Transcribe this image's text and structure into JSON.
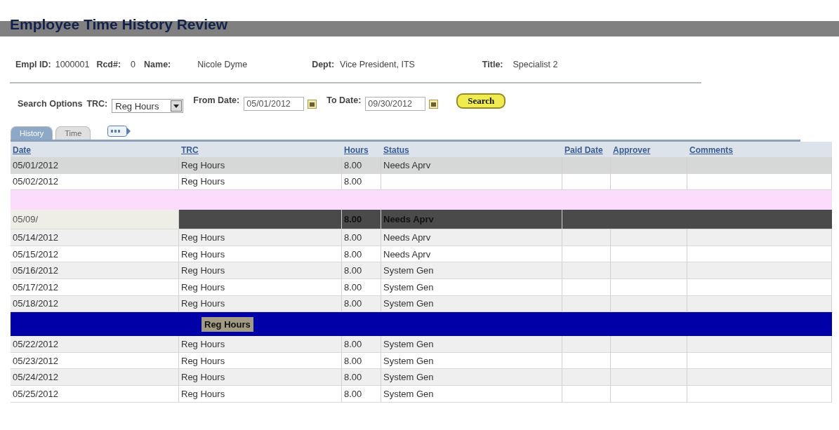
{
  "page_title": "Employee Time History Review",
  "employee": [
    {
      "label": "Empl ID:",
      "value": "1000001"
    },
    {
      "label": "Rcd#:",
      "value": "0"
    },
    {
      "label": "Name:",
      "value": "Nicole Dyme"
    },
    {
      "label": "Dept:",
      "value": "Vice President, ITS"
    },
    {
      "label": "Title:",
      "value": "Specialist 2"
    }
  ],
  "search": {
    "heading": "Search Options",
    "trc_label": "TRC:",
    "trc_value": "Reg Hours",
    "from_label": "From Date:",
    "from_value": "05/01/2012",
    "to_label": "To Date:",
    "to_value": "09/30/2012",
    "button": "Search"
  },
  "tabs": [
    {
      "label": "History",
      "selected": true
    },
    {
      "label": "Time",
      "selected": false
    }
  ],
  "table": {
    "columns": [
      "Date",
      "TRC",
      "Hours",
      "Status",
      "Paid Date",
      "Approver",
      "Comments"
    ],
    "rows": [
      {
        "kind": "row",
        "selected": true,
        "date": "05/01/2012",
        "trc": "Reg Hours",
        "hours": "8.00",
        "status": "Needs Aprv"
      },
      {
        "kind": "row",
        "selected": false,
        "date": "05/02/2012",
        "trc": "Reg Hours",
        "hours": "8.00"
      },
      {
        "kind": "glitch",
        "color": "#fcdcfc"
      },
      {
        "kind": "dark",
        "date": "05/09/",
        "hours": "8.00",
        "status": "Needs Aprv"
      },
      {
        "kind": "row",
        "selected": false,
        "date": "05/14/2012",
        "trc": "Reg Hours",
        "hours": "8.00",
        "status": "Needs Aprv"
      },
      {
        "kind": "row",
        "selected": false,
        "date": "05/15/2012",
        "trc": "Reg Hours",
        "hours": "8.00",
        "status": "Needs Aprv"
      },
      {
        "kind": "row",
        "selected": false,
        "date": "05/16/2012",
        "trc": "Reg Hours",
        "hours": "8.00",
        "status": "System Gen"
      },
      {
        "kind": "row",
        "selected": false,
        "date": "05/17/2012",
        "trc": "Reg Hours",
        "hours": "8.00",
        "status": "System Gen"
      },
      {
        "kind": "row",
        "selected": false,
        "date": "05/18/2012",
        "trc": "Reg Hours",
        "hours": "8.00",
        "status": "System Gen"
      },
      {
        "kind": "glitch",
        "color": "#0000a8",
        "trc": "Reg Hours"
      },
      {
        "kind": "row",
        "selected": false,
        "date": "05/22/2012",
        "trc": "Reg Hours",
        "hours": "8.00",
        "status": "System Gen"
      },
      {
        "kind": "row",
        "selected": false,
        "date": "05/23/2012",
        "trc": "Reg Hours",
        "hours": "8.00",
        "status": "System Gen"
      },
      {
        "kind": "row",
        "selected": false,
        "date": "05/24/2012",
        "trc": "Reg Hours",
        "hours": "8.00",
        "status": "System Gen"
      },
      {
        "kind": "row",
        "selected": false,
        "date": "05/25/2012",
        "trc": "Reg Hours",
        "hours": "8.00",
        "status": "System Gen"
      }
    ]
  }
}
